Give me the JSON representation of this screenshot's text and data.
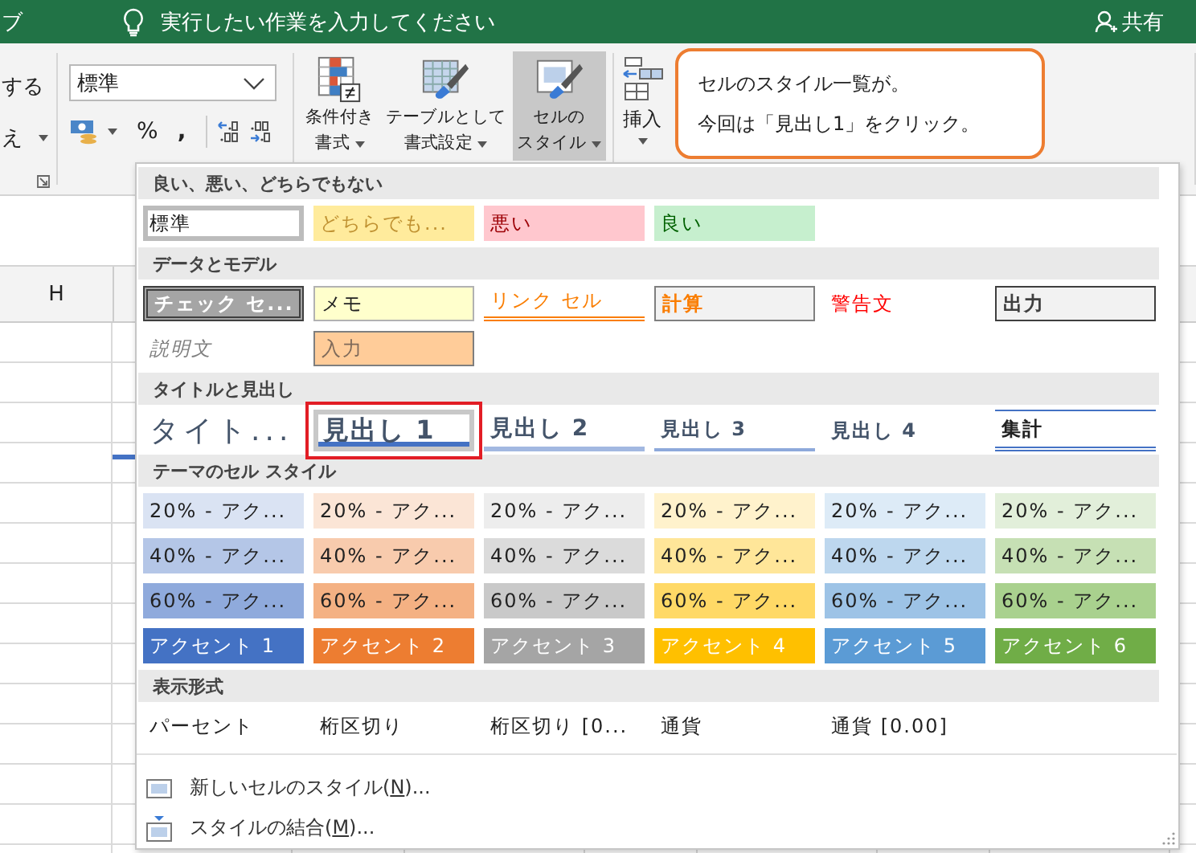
{
  "title_bar": {
    "app_fragment": "ブ",
    "tell_me": "実行したい作業を入力してください",
    "share": "共有"
  },
  "ribbon": {
    "left_labels": [
      "する",
      "え"
    ],
    "number": {
      "format_value": "標準",
      "percent": "%",
      "comma": ","
    },
    "style_buttons": [
      {
        "kind": "conditional",
        "lines": [
          "条件付き",
          "書式"
        ],
        "selected": false
      },
      {
        "kind": "table",
        "lines": [
          "テーブルとして",
          "書式設定"
        ],
        "selected": false
      },
      {
        "kind": "cellstyle",
        "lines": [
          "セルの",
          "スタイル"
        ],
        "selected": true
      }
    ],
    "insert": {
      "label": "挿入"
    }
  },
  "callout": {
    "lines": [
      "セルのスタイル一覧が。",
      "今回は「見出し1」をクリック。"
    ]
  },
  "sheet": {
    "column_header": "H"
  },
  "cell_styles": {
    "sections": [
      {
        "title": "良い、悪い、どちらでもない",
        "items": [
          {
            "kind": "normal",
            "label": "標準",
            "selected": true,
            "annotated": false
          },
          {
            "kind": "neutral",
            "label": "どちらでも...",
            "selected": false,
            "annotated": false
          },
          {
            "kind": "bad",
            "label": "悪い",
            "selected": false,
            "annotated": false
          },
          {
            "kind": "good",
            "label": "良い",
            "selected": false,
            "annotated": false
          }
        ]
      },
      {
        "title": "データとモデル",
        "items": [
          {
            "kind": "check",
            "label": "チェック セ...",
            "selected": false,
            "annotated": false
          },
          {
            "kind": "note",
            "label": "メモ",
            "selected": false,
            "annotated": false
          },
          {
            "kind": "linked",
            "label": "リンク セル",
            "selected": false,
            "annotated": false
          },
          {
            "kind": "calc",
            "label": "計算",
            "selected": false,
            "annotated": false
          },
          {
            "kind": "warning",
            "label": "警告文",
            "selected": false,
            "annotated": false
          },
          {
            "kind": "output",
            "label": "出力",
            "selected": false,
            "annotated": false
          },
          {
            "kind": "explanatory",
            "label": "説明文",
            "selected": false,
            "annotated": false
          },
          {
            "kind": "input",
            "label": "入力",
            "selected": false,
            "annotated": false
          }
        ]
      },
      {
        "title": "タイトルと見出し",
        "items": [
          {
            "kind": "title",
            "label": "タイト...",
            "selected": false,
            "annotated": false
          },
          {
            "kind": "heading1",
            "label": "見出し 1",
            "selected": true,
            "annotated": true
          },
          {
            "kind": "heading2",
            "label": "見出し 2",
            "selected": false,
            "annotated": false
          },
          {
            "kind": "heading3",
            "label": "見出し 3",
            "selected": false,
            "annotated": false
          },
          {
            "kind": "heading4",
            "label": "見出し 4",
            "selected": false,
            "annotated": false
          },
          {
            "kind": "total",
            "label": "集計",
            "selected": false,
            "annotated": false
          }
        ]
      },
      {
        "title": "テーマのセル スタイル",
        "items": [
          {
            "kind": "tint",
            "label": "20% - アク...",
            "color": "#dae3f3",
            "selected": false,
            "annotated": false
          },
          {
            "kind": "tint",
            "label": "20% - アク...",
            "color": "#fbe5d6",
            "selected": false,
            "annotated": false
          },
          {
            "kind": "tint",
            "label": "20% - アク...",
            "color": "#ededed",
            "selected": false,
            "annotated": false
          },
          {
            "kind": "tint",
            "label": "20% - アク...",
            "color": "#fff2cc",
            "selected": false,
            "annotated": false
          },
          {
            "kind": "tint",
            "label": "20% - アク...",
            "color": "#ddebf7",
            "selected": false,
            "annotated": false
          },
          {
            "kind": "tint",
            "label": "20% - アク...",
            "color": "#e2efda",
            "selected": false,
            "annotated": false
          },
          {
            "kind": "tint",
            "label": "40% - アク...",
            "color": "#b4c6e7",
            "selected": false,
            "annotated": false
          },
          {
            "kind": "tint",
            "label": "40% - アク...",
            "color": "#f8cbad",
            "selected": false,
            "annotated": false
          },
          {
            "kind": "tint",
            "label": "40% - アク...",
            "color": "#dbdbdb",
            "selected": false,
            "annotated": false
          },
          {
            "kind": "tint",
            "label": "40% - アク...",
            "color": "#ffe699",
            "selected": false,
            "annotated": false
          },
          {
            "kind": "tint",
            "label": "40% - アク...",
            "color": "#bdd7ee",
            "selected": false,
            "annotated": false
          },
          {
            "kind": "tint",
            "label": "40% - アク...",
            "color": "#c6e0b4",
            "selected": false,
            "annotated": false
          },
          {
            "kind": "tint",
            "label": "60% - アク...",
            "color": "#8faadc",
            "selected": false,
            "annotated": false
          },
          {
            "kind": "tint",
            "label": "60% - アク...",
            "color": "#f4b183",
            "selected": false,
            "annotated": false
          },
          {
            "kind": "tint",
            "label": "60% - アク...",
            "color": "#c9c9c9",
            "selected": false,
            "annotated": false
          },
          {
            "kind": "tint",
            "label": "60% - アク...",
            "color": "#ffd966",
            "selected": false,
            "annotated": false
          },
          {
            "kind": "tint",
            "label": "60% - アク...",
            "color": "#9dc3e6",
            "selected": false,
            "annotated": false
          },
          {
            "kind": "tint",
            "label": "60% - アク...",
            "color": "#a9d18e",
            "selected": false,
            "annotated": false
          },
          {
            "kind": "accent",
            "label": "アクセント 1",
            "color": "#4472c4",
            "selected": false,
            "annotated": false
          },
          {
            "kind": "accent",
            "label": "アクセント 2",
            "color": "#ed7d31",
            "selected": false,
            "annotated": false
          },
          {
            "kind": "accent",
            "label": "アクセント 3",
            "color": "#a5a5a5",
            "selected": false,
            "annotated": false
          },
          {
            "kind": "accent",
            "label": "アクセント 4",
            "color": "#ffc000",
            "selected": false,
            "annotated": false
          },
          {
            "kind": "accent",
            "label": "アクセント 5",
            "color": "#5b9bd5",
            "selected": false,
            "annotated": false
          },
          {
            "kind": "accent",
            "label": "アクセント 6",
            "color": "#70ad47",
            "selected": false,
            "annotated": false
          }
        ]
      },
      {
        "title": "表示形式",
        "items": [
          {
            "kind": "plain",
            "label": "パーセント",
            "selected": false,
            "annotated": false
          },
          {
            "kind": "plain",
            "label": "桁区切り",
            "selected": false,
            "annotated": false
          },
          {
            "kind": "plain",
            "label": "桁区切り [0...",
            "selected": false,
            "annotated": false
          },
          {
            "kind": "plain",
            "label": "通貨",
            "selected": false,
            "annotated": false
          },
          {
            "kind": "plain",
            "label": "通貨 [0.00]",
            "selected": false,
            "annotated": false
          }
        ]
      }
    ],
    "commands": [
      {
        "kind": "new",
        "before": "新しいセルのスタイル(",
        "key": "N",
        "after": ")..."
      },
      {
        "kind": "merge",
        "before": "スタイルの結合(",
        "key": "M",
        "after": ")..."
      }
    ]
  }
}
